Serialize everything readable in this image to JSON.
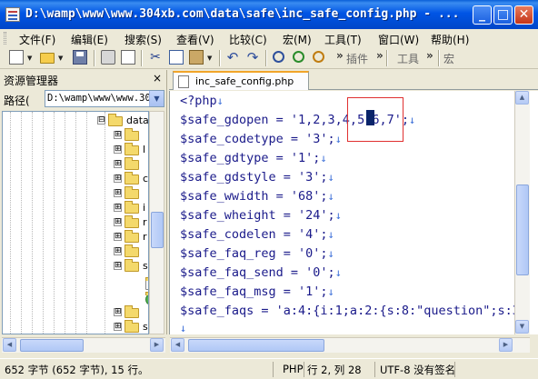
{
  "window": {
    "title": "D:\\wamp\\www\\www.304xb.com\\data\\safe\\inc_safe_config.php - ...",
    "minimize": "_",
    "maximize": "□",
    "close": "✕"
  },
  "menu": [
    "文件(F)",
    "编辑(E)",
    "搜索(S)",
    "查看(V)",
    "比较(C)",
    "宏(M)",
    "工具(T)",
    "窗口(W)",
    "帮助(H)"
  ],
  "toolbar": {
    "plugins_label": "插件",
    "tools_label": "工具",
    "macro_label": "宏",
    "more": "»",
    "icons": [
      "new-file-icon",
      "open-folder-icon",
      "save-icon",
      "print-icon",
      "print-preview-icon",
      "cut-icon",
      "copy-icon",
      "paste-icon",
      "undo-icon",
      "redo-icon",
      "find-icon",
      "find-next-icon",
      "replace-icon"
    ]
  },
  "explorer": {
    "title": "资源管理器",
    "close": "×",
    "path_label": "路径(",
    "path_value": "D:\\wamp\\www\\www.304",
    "tree": [
      {
        "expander": "⊟",
        "name": "data"
      },
      {
        "expander": "⊞",
        "name": ""
      },
      {
        "expander": "⊞",
        "name": "l"
      },
      {
        "expander": "⊞",
        "name": ""
      },
      {
        "expander": "⊞",
        "name": "c"
      },
      {
        "expander": "⊞",
        "name": ""
      },
      {
        "expander": "⊞",
        "name": "i"
      },
      {
        "expander": "⊞",
        "name": "r"
      },
      {
        "expander": "⊞",
        "name": "r"
      },
      {
        "expander": "⊞",
        "name": ""
      },
      {
        "expander": "⊞",
        "name": "s"
      },
      {
        "expander": "⊞",
        "name": ""
      },
      {
        "expander": "⊞",
        "name": "s"
      }
    ]
  },
  "editor": {
    "tab_label": "inc_safe_config.php",
    "eol_mark": "↓",
    "lines": [
      "<?php",
      "$safe_gdopen = '1,2,3,4,5,6,7';",
      "$safe_codetype = '3';",
      "$safe_gdtype = '1';",
      "$safe_gdstyle = '3';",
      "$safe_wwidth = '68';",
      "$safe_wheight = '24';",
      "$safe_codelen = '4';",
      "$safe_faq_reg = '0';",
      "$safe_faq_send = '0';",
      "$safe_faq_msg = '1';",
      "$safe_faqs = 'a:4:{i:1;a:2:{s:8:\"question\";s:3",
      ""
    ]
  },
  "status": {
    "size": "652 字节 (652 字节), 15 行。",
    "language": "PHP",
    "position": "行 2, 列 28",
    "encoding": "UTF-8 没有签名"
  }
}
